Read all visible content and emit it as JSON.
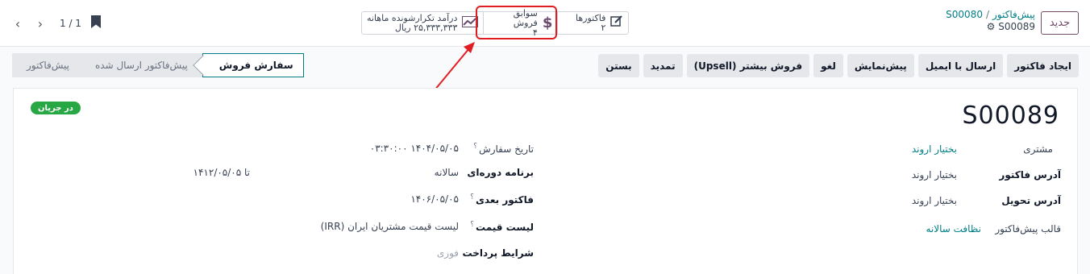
{
  "pager": {
    "prev_icon": "chevron-left-icon",
    "next_icon": "chevron-right-icon",
    "count": "1 / 1"
  },
  "smart_buttons": {
    "invoices": {
      "label": "فاکتورها",
      "value": "۲",
      "icon": "pencil-square-icon"
    },
    "sales_history": {
      "label": "سوابق فروش",
      "value": "۴",
      "icon": "dollar-icon"
    },
    "mrr": {
      "label": "درآمد تکرارشونده ماهانه",
      "value": "۲۵,۳۳۳,۳۳۳ ریال",
      "icon": "trend-up-icon"
    }
  },
  "breadcrumb": {
    "parent": "پیش‌فاکتور",
    "current": "S00080",
    "record": "S00089"
  },
  "new_button": "جدید",
  "actions": [
    "ایجاد فاکتور",
    "ارسال با ایمیل",
    "پیش‌نمایش",
    "لغو",
    "فروش بیشتر (Upsell)",
    "تمدید",
    "بستن"
  ],
  "status_steps": {
    "active": "سفارش فروش",
    "sent": "پیش‌فاکتور ارسال شده",
    "draft": "پیش‌فاکتور"
  },
  "badge": "در جریان",
  "order_name": "S00089",
  "left_fields": {
    "customer_label": "مشتری",
    "customer_value": "بختیار اروند",
    "invoice_addr_label": "آدرس فاکتور",
    "invoice_addr_value": "بختیار اروند",
    "delivery_addr_label": "آدرس تحویل",
    "delivery_addr_value": "بختیار اروند",
    "template_label": "قالب پیش‌فاکتور",
    "template_value": "نظافت سالانه"
  },
  "right_fields": {
    "order_date_label": "تاریخ سفارش",
    "order_date_value": "۱۴۰۴/۰۵/۰۵ ۰۳:۳۰:۰۰",
    "plan_label": "برنامه دوره‌ای",
    "plan_value": "سالانه",
    "plan_end": "تا ۱۴۱۲/۰۵/۰۵",
    "next_invoice_label": "فاکتور بعدی",
    "next_invoice_value": "۱۴۰۶/۰۵/۰۵",
    "pricelist_label": "لیست قیمت",
    "pricelist_value": "لیست قیمت مشتریان ایران (IRR)",
    "payment_terms_label": "شرایط پرداخت",
    "payment_terms_value": "فوری"
  },
  "help_mark": "؟",
  "colors": {
    "accent": "#017e84",
    "brand": "#714b67",
    "highlight": "#e11d24",
    "badge": "#28a745"
  }
}
